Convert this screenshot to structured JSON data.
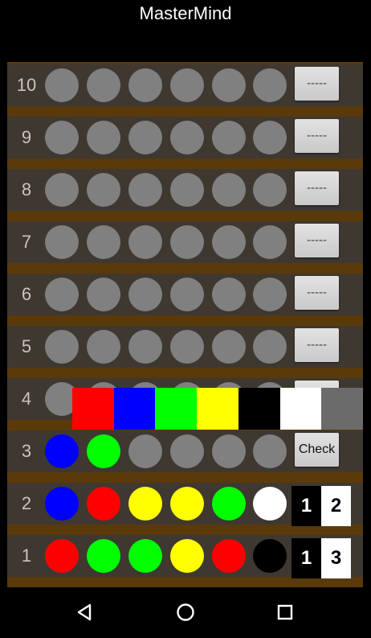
{
  "app": {
    "title": "MasterMind"
  },
  "board": {
    "rows": [
      {
        "number": "10",
        "pegs": [
          "gray",
          "gray",
          "gray",
          "gray",
          "gray",
          "gray"
        ],
        "button": "-----"
      },
      {
        "number": "9",
        "pegs": [
          "gray",
          "gray",
          "gray",
          "gray",
          "gray",
          "gray"
        ],
        "button": "-----"
      },
      {
        "number": "8",
        "pegs": [
          "gray",
          "gray",
          "gray",
          "gray",
          "gray",
          "gray"
        ],
        "button": "-----"
      },
      {
        "number": "7",
        "pegs": [
          "gray",
          "gray",
          "gray",
          "gray",
          "gray",
          "gray"
        ],
        "button": "-----"
      },
      {
        "number": "6",
        "pegs": [
          "gray",
          "gray",
          "gray",
          "gray",
          "gray",
          "gray"
        ],
        "button": "-----"
      },
      {
        "number": "5",
        "pegs": [
          "gray",
          "gray",
          "gray",
          "gray",
          "gray",
          "gray"
        ],
        "button": "-----"
      },
      {
        "number": "4",
        "pegs": [
          "gray",
          "gray",
          "gray",
          "gray",
          "gray",
          "gray"
        ],
        "button": "-----"
      },
      {
        "number": "3",
        "pegs": [
          "blue",
          "green",
          "gray",
          "gray",
          "gray",
          "gray"
        ],
        "button": "Check"
      },
      {
        "number": "2",
        "pegs": [
          "blue",
          "red",
          "yellow",
          "yellow",
          "green",
          "white"
        ],
        "score_black": "1",
        "score_white": "2"
      },
      {
        "number": "1",
        "pegs": [
          "red",
          "green",
          "green",
          "yellow",
          "red",
          "black"
        ],
        "score_black": "1",
        "score_white": "3"
      }
    ]
  },
  "palette": [
    "red",
    "blue",
    "green",
    "yellow",
    "black",
    "white",
    "gray"
  ],
  "colors": {
    "red": "#ff0000",
    "blue": "#0000ff",
    "green": "#00ff00",
    "yellow": "#ffff00",
    "black": "#000000",
    "white": "#ffffff",
    "gray": "#808080",
    "palette_gray": "#6b6b6b"
  },
  "navbar": {
    "icons": [
      "back-icon",
      "home-icon",
      "recents-icon"
    ]
  }
}
